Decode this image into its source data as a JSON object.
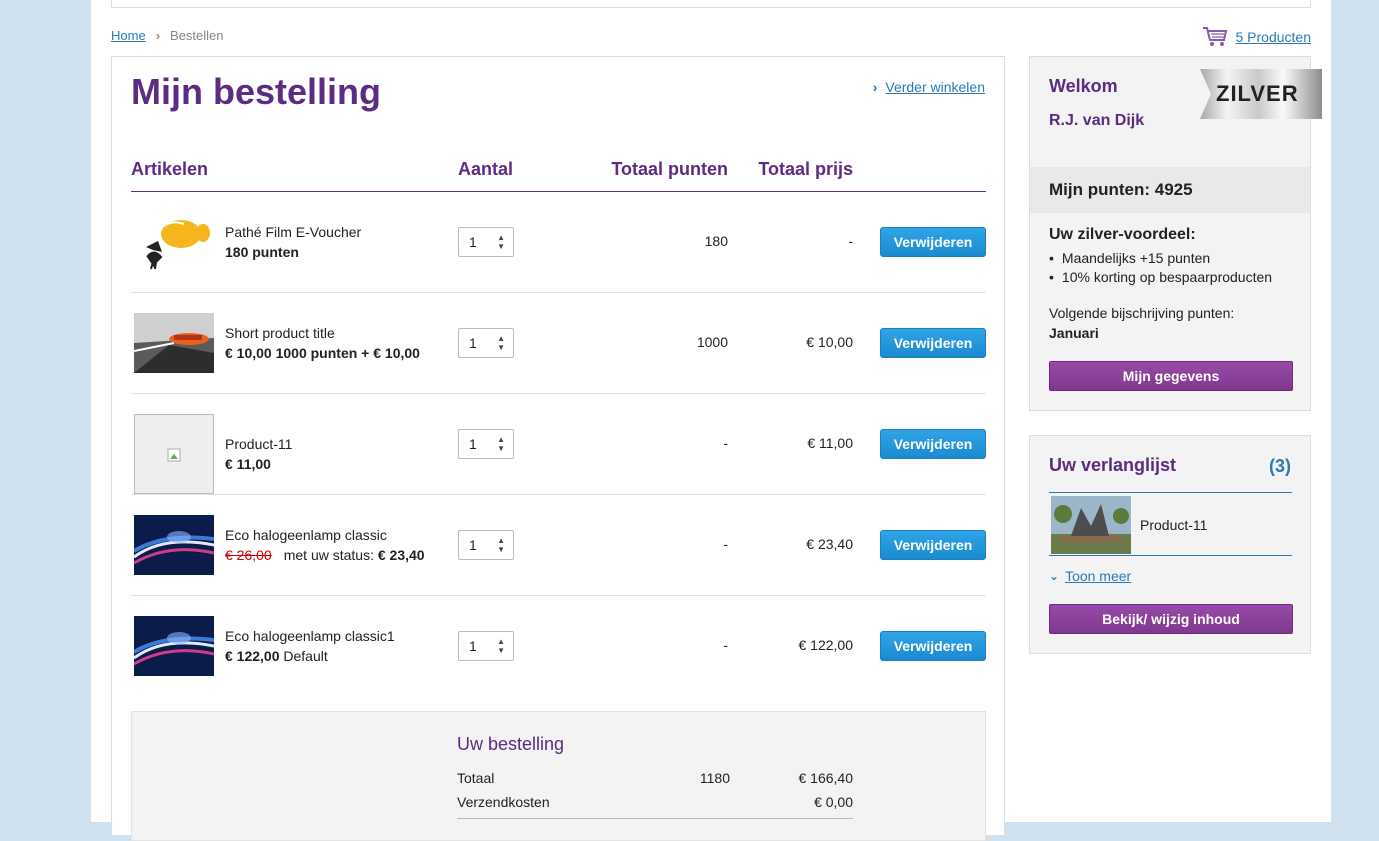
{
  "breadcrumb": {
    "home": "Home",
    "current": "Bestellen",
    "separator": "›"
  },
  "cart": {
    "label": "5 Producten"
  },
  "main": {
    "title": "Mijn bestelling",
    "continue_label": "Verder winkelen",
    "columns": {
      "articles": "Artikelen",
      "quantity": "Aantal",
      "total_points": "Totaal punten",
      "total_price": "Totaal prijs"
    },
    "remove_label": "Verwijderen",
    "items": [
      {
        "name": "Pathé Film E-Voucher",
        "sub_bold": "180 punten",
        "sub_extra": "",
        "qty": "1",
        "points": "180",
        "price": "-"
      },
      {
        "name": "Short product title",
        "sub_bold": "€ 10,00 1000 punten + € 10,00",
        "sub_extra": "",
        "qty": "1",
        "points": "1000",
        "price": "€ 10,00"
      },
      {
        "name": "Product-11",
        "sub_bold": "€ 11,00",
        "sub_extra": "",
        "qty": "1",
        "points": "-",
        "price": "€ 11,00"
      },
      {
        "name": "Eco halogeenlamp classic",
        "old_price": "€ 26,00",
        "sub_extra": "met uw status:",
        "sub_bold": "€ 23,40",
        "qty": "1",
        "points": "-",
        "price": "€ 23,40"
      },
      {
        "name": "Eco halogeenlamp classic1",
        "sub_bold": "€ 122,00",
        "sub_extra": "Default",
        "qty": "1",
        "points": "-",
        "price": "€ 122,00"
      }
    ],
    "summary": {
      "heading": "Uw bestelling",
      "total_label": "Totaal",
      "total_points": "1180",
      "total_price": "€ 166,40",
      "shipping_label": "Verzendkosten",
      "shipping_price": "€ 0,00"
    }
  },
  "account": {
    "welcome": "Welkom",
    "user": "R.J. van Dijk",
    "tier": "ZILVER",
    "points": "Mijn punten: 4925",
    "advantage_title": "Uw zilver-voordeel:",
    "advantages": [
      "Maandelijks +15 punten",
      "10% korting op bespaarproducten"
    ],
    "next_credit_label": "Volgende bijschrijving punten:",
    "next_credit_month": "Januari",
    "button": "Mijn gegevens"
  },
  "wishlist": {
    "title": "Uw verlanglijst",
    "count": "(3)",
    "item_name": "Product-11",
    "more_label": "Toon meer",
    "button": "Bekijk/ wijzig inhoud"
  },
  "colors": {
    "brand_purple": "#5b2c83",
    "button_blue": "#1b8bd0",
    "link_blue": "#2a7ab8",
    "button_purple": "#80388f"
  }
}
